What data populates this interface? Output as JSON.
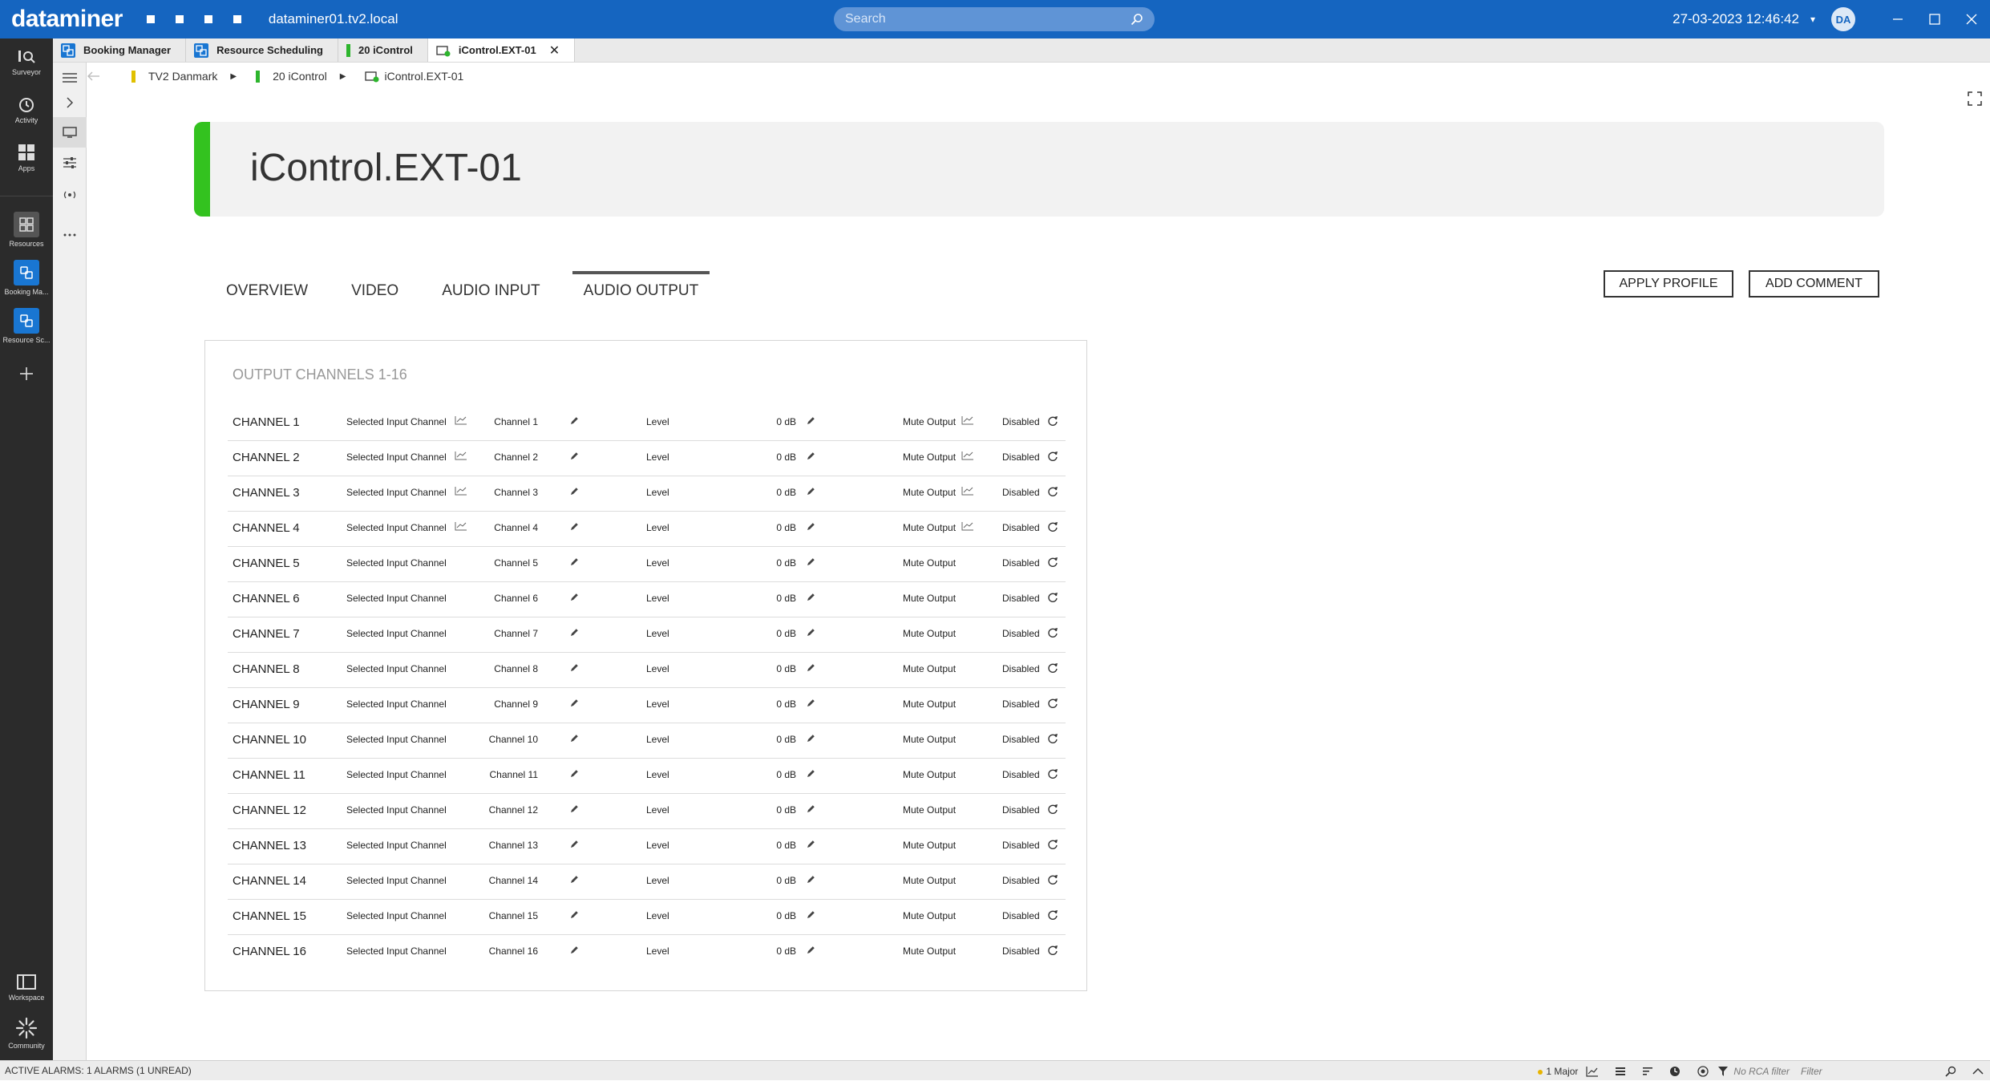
{
  "app": {
    "brand": "dataminer",
    "host": "dataminer01.tv2.local",
    "datetime": "27-03-2023 12:46:42",
    "avatar": "DA"
  },
  "search": {
    "placeholder": "Search"
  },
  "rail": {
    "items": [
      {
        "label": "Surveyor",
        "icon": "surveyor-icon"
      },
      {
        "label": "Activity",
        "icon": "activity-icon"
      },
      {
        "label": "Apps",
        "icon": "apps-icon"
      },
      {
        "label": "Resources",
        "icon": "resources-icon"
      },
      {
        "label": "Booking Ma...",
        "icon": "booking-app-icon"
      },
      {
        "label": "Resource Sc...",
        "icon": "resource-scheduling-app-icon"
      },
      {
        "label": "Workspace",
        "icon": "workspace-icon"
      },
      {
        "label": "Community",
        "icon": "community-icon"
      }
    ]
  },
  "tabs": [
    {
      "label": "Booking Manager"
    },
    {
      "label": "Resource Scheduling"
    },
    {
      "label": "20 iControl"
    },
    {
      "label": "iControl.EXT-01"
    }
  ],
  "breadcrumb": [
    "TV2 Danmark",
    "20 iControl",
    "iControl.EXT-01"
  ],
  "header": {
    "title": "iControl.EXT-01"
  },
  "nav": [
    "OVERVIEW",
    "VIDEO",
    "AUDIO INPUT",
    "AUDIO OUTPUT"
  ],
  "actions": {
    "apply_profile": "APPLY PROFILE",
    "add_comment": "ADD COMMENT"
  },
  "panel": {
    "title": "OUTPUT CHANNELS 1-16",
    "labels": {
      "selected_input": "Selected Input Channel",
      "level": "Level",
      "mute": "Mute Output"
    },
    "channels": [
      {
        "name": "CHANNEL 1",
        "input": "Channel 1",
        "level": "0 dB",
        "mute": "Disabled"
      },
      {
        "name": "CHANNEL 2",
        "input": "Channel 2",
        "level": "0 dB",
        "mute": "Disabled"
      },
      {
        "name": "CHANNEL 3",
        "input": "Channel 3",
        "level": "0 dB",
        "mute": "Disabled"
      },
      {
        "name": "CHANNEL 4",
        "input": "Channel 4",
        "level": "0 dB",
        "mute": "Disabled"
      },
      {
        "name": "CHANNEL 5",
        "input": "Channel 5",
        "level": "0 dB",
        "mute": "Disabled"
      },
      {
        "name": "CHANNEL 6",
        "input": "Channel 6",
        "level": "0 dB",
        "mute": "Disabled"
      },
      {
        "name": "CHANNEL 7",
        "input": "Channel 7",
        "level": "0 dB",
        "mute": "Disabled"
      },
      {
        "name": "CHANNEL 8",
        "input": "Channel 8",
        "level": "0 dB",
        "mute": "Disabled"
      },
      {
        "name": "CHANNEL 9",
        "input": "Channel 9",
        "level": "0 dB",
        "mute": "Disabled"
      },
      {
        "name": "CHANNEL 10",
        "input": "Channel 10",
        "level": "0 dB",
        "mute": "Disabled"
      },
      {
        "name": "CHANNEL 11",
        "input": "Channel 11",
        "level": "0 dB",
        "mute": "Disabled"
      },
      {
        "name": "CHANNEL 12",
        "input": "Channel 12",
        "level": "0 dB",
        "mute": "Disabled"
      },
      {
        "name": "CHANNEL 13",
        "input": "Channel 13",
        "level": "0 dB",
        "mute": "Disabled"
      },
      {
        "name": "CHANNEL 14",
        "input": "Channel 14",
        "level": "0 dB",
        "mute": "Disabled"
      },
      {
        "name": "CHANNEL 15",
        "input": "Channel 15",
        "level": "0 dB",
        "mute": "Disabled"
      },
      {
        "name": "CHANNEL 16",
        "input": "Channel 16",
        "level": "0 dB",
        "mute": "Disabled"
      }
    ]
  },
  "status": {
    "alarms": "ACTIVE ALARMS: 1 ALARMS (1 UNREAD)",
    "major": "1 Major",
    "rca": "No RCA filter",
    "filter_placeholder": "Filter"
  },
  "colors": {
    "brand": "#1565c0",
    "accent_green": "#33c21f",
    "rail": "#2b2b2b",
    "major_dot": "#e8b400"
  }
}
